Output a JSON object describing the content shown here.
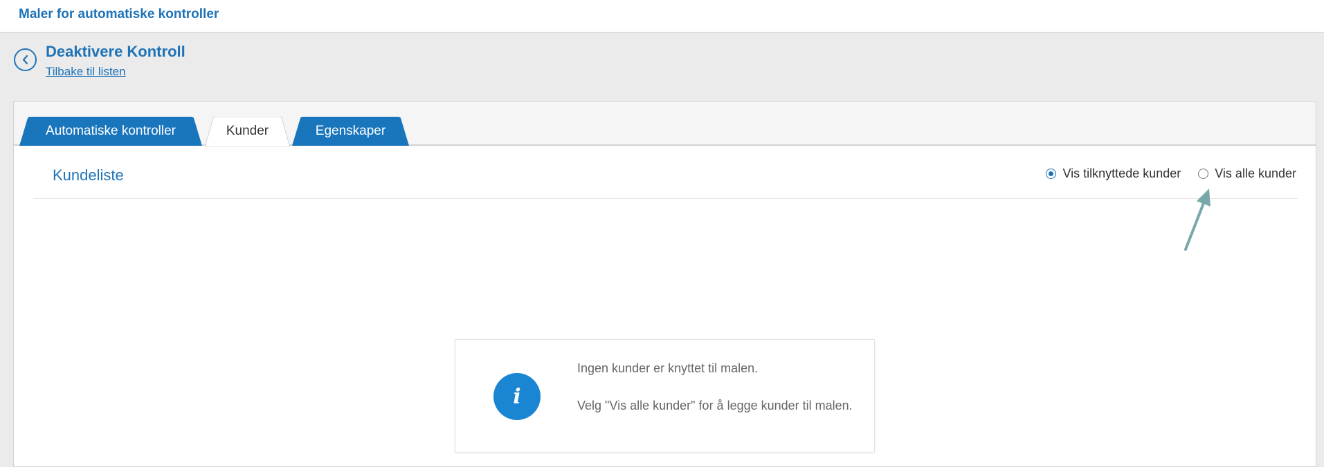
{
  "header": {
    "app_title": "Maler for automatiske kontroller"
  },
  "page": {
    "title": "Deaktivere Kontroll",
    "back_link": "Tilbake til listen"
  },
  "tabs": [
    {
      "label": "Automatiske kontroller",
      "active": false
    },
    {
      "label": "Kunder",
      "active": true
    },
    {
      "label": "Egenskaper",
      "active": false
    }
  ],
  "customer_list": {
    "title": "Kundeliste",
    "filter": {
      "options": [
        {
          "label": "Vis tilknyttede kunder",
          "checked": true
        },
        {
          "label": "Vis alle kunder",
          "checked": false
        }
      ]
    }
  },
  "info": {
    "icon": "info-icon",
    "line1": "Ingen kunder er knyttet til malen.",
    "line2": "Velg \"Vis alle kunder\" for å legge kunder til malen."
  },
  "colors": {
    "accent": "#1e73b7",
    "tab_inactive": "#1a76bc",
    "info_icon": "#1a86d3",
    "annotation_arrow": "#79a8ac"
  }
}
